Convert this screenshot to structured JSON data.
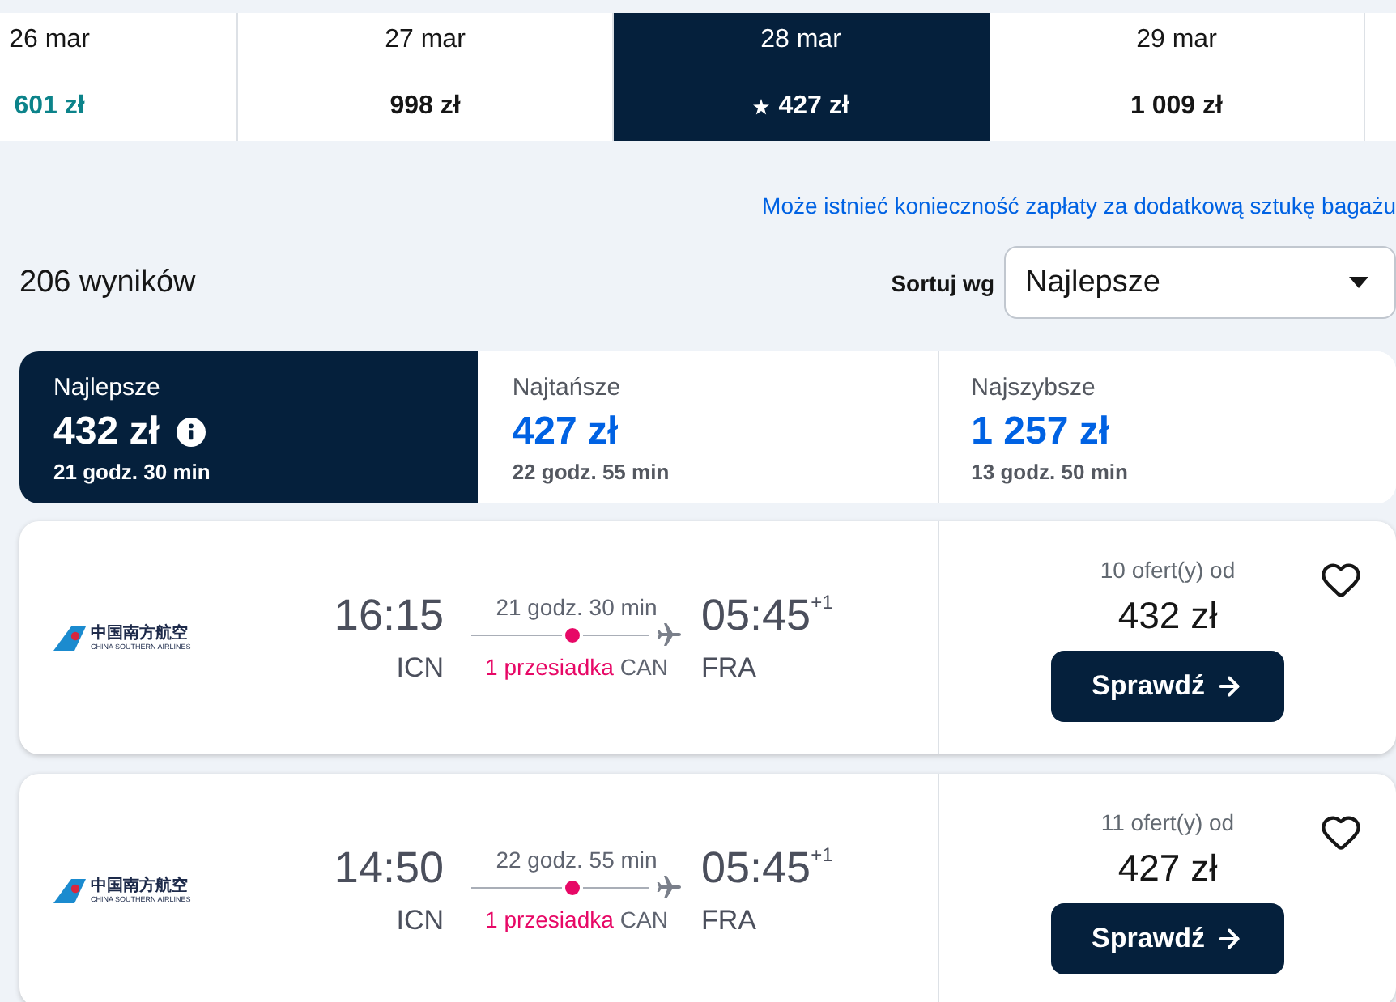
{
  "date_strip": [
    {
      "date": "26 mar",
      "price": "601 zł",
      "selected": false,
      "starred": false,
      "color": "#0c838a"
    },
    {
      "date": "27 mar",
      "price": "998 zł",
      "selected": false,
      "starred": false
    },
    {
      "date": "28 mar",
      "price": "427 zł",
      "selected": true,
      "starred": true
    },
    {
      "date": "29 mar",
      "price": "1 009 zł",
      "selected": false,
      "starred": false
    }
  ],
  "baggage_notice": "Może istnieć konieczność zapłaty za dodatkową sztukę bagażu",
  "results_count": "206 wyników",
  "sort": {
    "label": "Sortuj wg",
    "value": "Najlepsze"
  },
  "tabs": [
    {
      "label": "Najlepsze",
      "price": "432 zł",
      "duration": "21 godz. 30 min",
      "selected": true,
      "info": true
    },
    {
      "label": "Najtańsze",
      "price": "427 zł",
      "duration": "22 godz. 55 min",
      "selected": false,
      "info": false
    },
    {
      "label": "Najszybsze",
      "price": "1 257 zł",
      "duration": "13 godz. 50 min",
      "selected": false,
      "info": false
    }
  ],
  "flights": [
    {
      "airline_name_zh": "中国南方航空",
      "airline_name_en": "CHINA SOUTHERN AIRLINES",
      "depart_time": "16:15",
      "depart_airport": "ICN",
      "duration": "21 godz. 30 min",
      "stops": "1 przesiadka",
      "via": "CAN",
      "arrive_time": "05:45",
      "day_offset": "+1",
      "arrive_airport": "FRA",
      "offers": "10 ofert(y) od",
      "price": "432 zł",
      "button": "Sprawdź",
      "saved": false
    },
    {
      "airline_name_zh": "中国南方航空",
      "airline_name_en": "CHINA SOUTHERN AIRLINES",
      "depart_time": "14:50",
      "depart_airport": "ICN",
      "duration": "22 godz. 55 min",
      "stops": "1 przesiadka",
      "via": "CAN",
      "arrive_time": "05:45",
      "day_offset": "+1",
      "arrive_airport": "FRA",
      "offers": "11 ofert(y) od",
      "price": "427 zł",
      "button": "Sprawdź",
      "saved": false
    }
  ]
}
